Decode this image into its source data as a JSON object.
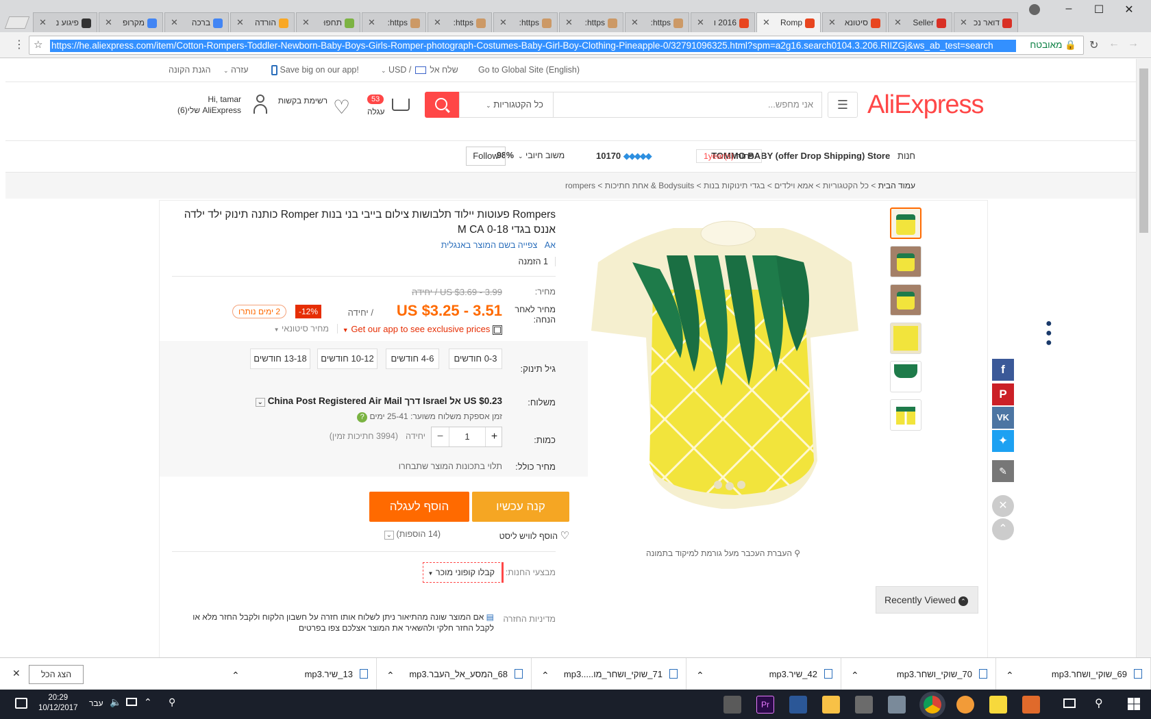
{
  "browser": {
    "tabs": [
      {
        "title": "דואר נכ",
        "icon_color": "#d93025"
      },
      {
        "title": "Seller",
        "icon_color": "#d93025"
      },
      {
        "title": "סיטונא",
        "icon_color": "#e8451f"
      },
      {
        "title": "Romp",
        "icon_color": "#e8451f",
        "active": true
      },
      {
        "title": "2016 ו",
        "icon_color": "#e8451f"
      },
      {
        "title": "https:",
        "icon_color": "#c96"
      },
      {
        "title": "https:",
        "icon_color": "#c96"
      },
      {
        "title": "https:",
        "icon_color": "#c96"
      },
      {
        "title": "https:",
        "icon_color": "#c96"
      },
      {
        "title": "https:",
        "icon_color": "#c96"
      },
      {
        "title": "תחפוּ",
        "icon_color": "#7cb342"
      },
      {
        "title": "הורדה",
        "icon_color": "#f9a825"
      },
      {
        "title": "ברכה",
        "icon_color": "#4285f4"
      },
      {
        "title": "מקרופ",
        "icon_color": "#4285f4"
      },
      {
        "title": "פיגוע נ",
        "icon_color": "#333"
      }
    ],
    "url": "https://he.aliexpress.com/item/Cotton-Rompers-Toddler-Newborn-Baby-Boys-Girls-Romper-photograph-Costumes-Baby-Girl-Boy-Clothing-Pineapple-0/32791096325.html?spm=a2g16.search0104.3.206.RIIZGj&ws_ab_test=search",
    "secure_label": "מאובטח"
  },
  "topbar": {
    "global_site": "Go to Global Site (English)",
    "ship_to": "שלח אל",
    "currency": "USD",
    "app_promo": "Save big on our app!",
    "help": "עזרה",
    "buyer_protection": "הגנת הקונה"
  },
  "header": {
    "logo": "AliExpress",
    "search_placeholder": "אני מחפש...",
    "category_select": "כל הקטגוריות",
    "cart_count": "53",
    "cart_label": "עגלה",
    "wishlist_label": "רשימת בקשות",
    "user_greeting": "Hi, tamar",
    "user_account": "AliExpress שלי",
    "user_count": "(6)"
  },
  "store": {
    "name": "TOMMO BABY (offer Drop Shipping) Store",
    "store_label": "חנות",
    "open_label": "פתוח:",
    "open_years": "1",
    "years_unit": "year(s)",
    "score": "10170",
    "feedback_label": "משוב חיובי",
    "feedback_pct": "98%",
    "follow": "Follow"
  },
  "breadcrumb": {
    "items": [
      "עמוד הבית",
      "כל הקטגוריות",
      "אמא וילדים",
      "בגדי תינוקות בנות",
      "Bodysuits & אחת חתיכות",
      "rompers"
    ]
  },
  "product": {
    "title": "Rompers פעוטות יילוד תלבושות צילום בייבי בני בנות Romper כותנה תינוק ילד ילדה אננס בגדי 0-18 M CA",
    "view_english": "צפייה בשם המוצר באנגלית",
    "orders": "1 הזמנה",
    "price_label": "מחיר:",
    "original_price": "US $3.69 - 3.99",
    "per_unit_old": "/ יחידה",
    "discount_label": "מחיר לאחר הנחה:",
    "sale_price": "US $3.25 - 3.51",
    "per_unit": "/ יחידה",
    "discount_badge": "-12%",
    "days_left": "2 ימים נותרו",
    "app_promo": "Get our app to see exclusive prices",
    "wholesale": "מחיר סיטונאי",
    "age_label": "גיל תינוק:",
    "age_options": [
      "0-3 חודשים",
      "4-6 חודשים",
      "10-12 חודשים",
      "13-18 חודשים"
    ],
    "shipping_label": "משלוח:",
    "shipping_text": "US $0.23 אל Israel דרך China Post Registered Air Mail",
    "delivery_time": "זמן אספקת משלוח משוער: 25-41 ימים",
    "quantity_label": "כמות:",
    "quantity_value": "1",
    "quantity_unit": "יחידה",
    "stock": "(3994 חתיכות זמין)",
    "total_label": "מחיר כולל:",
    "total_value": "תלוי בתכונות המוצר שתבחרו",
    "buy_now": "קנה עכשיו",
    "add_to_cart": "הוסף לעגלה",
    "add_wishlist": "הוסף לוויש ליסט",
    "wishlist_adds": "(14 הוספות)",
    "promos_label": "מבצעי החנות:",
    "coupon": "קבלו קופוני מוכר",
    "return_label": "מדיניות החזרה",
    "return_text": "אם המוצר שונה מהתיאור ניתן לשלוח אותו חזרה על חשבון הלקוח ולקבל החזר מלא או לקבל החזר חלקי ולהשאיר את המוצר אצלכם צפו בפרטים",
    "zoom_hint": "העברת העכבר מעל גורמת למיקוד בתמונה",
    "recently_viewed": "Recently Viewed"
  },
  "downloads": [
    "69_שוקי_ושחר.mp3",
    "70_שוקי_ושחר.mp3",
    "42_שיר.mp3",
    "71_שוקי_ושחר_מו.....mp3",
    "68_המסע_אל_העבר.mp3",
    "13_שיר.mp3"
  ],
  "downloads_show_all": "הצג הכל",
  "taskbar": {
    "time": "20:29",
    "date": "10/12/2017",
    "lang": "עבר"
  },
  "colors": {
    "accent": "#ff4747",
    "orange_btn": "#f5a623",
    "cart_btn": "#ff6a00"
  }
}
